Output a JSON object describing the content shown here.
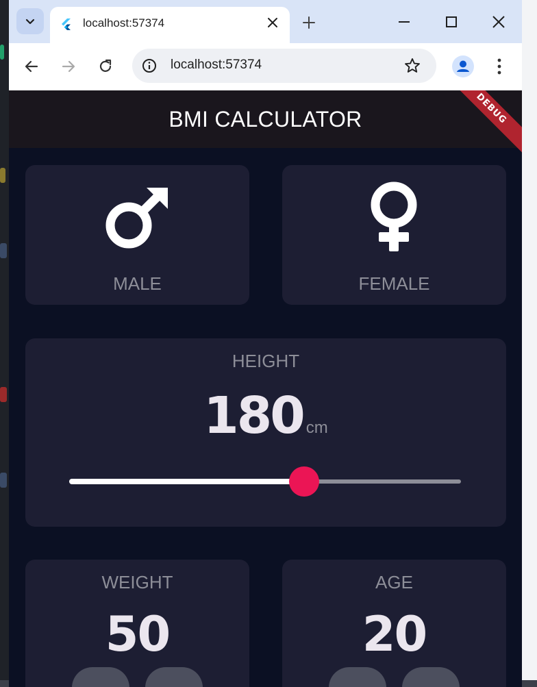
{
  "browser": {
    "tab_title": "localhost:57374",
    "url": "localhost:57374"
  },
  "app": {
    "title": "BMI CALCULATOR",
    "debug_banner": "DEBUG",
    "gender": {
      "male_label": "MALE",
      "female_label": "FEMALE"
    },
    "height": {
      "label": "HEIGHT",
      "value": "180",
      "unit": "cm",
      "slider_fraction": 0.6
    },
    "weight": {
      "label": "WEIGHT",
      "value": "50"
    },
    "age": {
      "label": "AGE",
      "value": "20"
    }
  },
  "colors": {
    "background": "#0b1023",
    "card": "#1d1e33",
    "appbar": "#1a161d",
    "accent": "#eb1555",
    "label": "#8d8e98"
  },
  "icons": [
    "chevron-down-icon",
    "flutter-favicon-icon",
    "close-icon",
    "plus-icon",
    "minimize-icon",
    "maximize-icon",
    "back-arrow-icon",
    "forward-arrow-icon",
    "reload-icon",
    "info-icon",
    "star-icon",
    "profile-icon",
    "kebab-menu-icon",
    "mars-icon",
    "venus-icon"
  ]
}
